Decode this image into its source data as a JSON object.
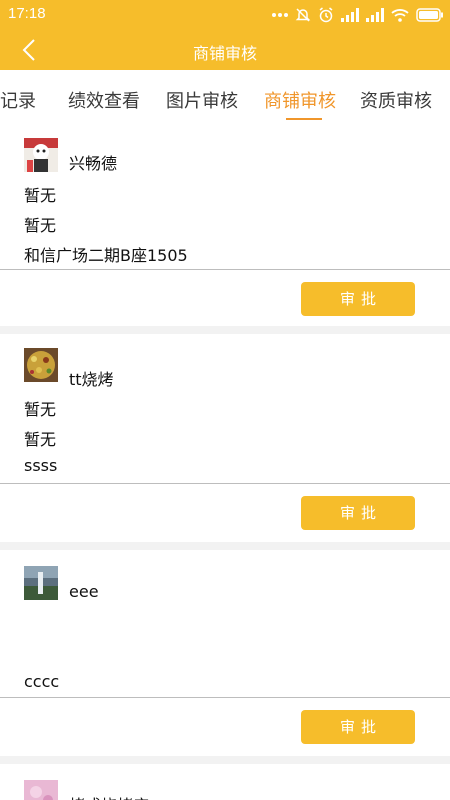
{
  "status_bar": {
    "time": "17:18",
    "icons": [
      "dots-icon",
      "mute-icon",
      "alarm-icon",
      "signal-icon",
      "signal-icon",
      "wifi-icon",
      "battery-icon"
    ]
  },
  "header": {
    "title": "商铺审核",
    "back_icon": "chevron-left-icon"
  },
  "colors": {
    "accent": "#f6bd2b",
    "active_tab": "#f0962b",
    "divider": "#bdbdbd",
    "separator": "#f2f2f2"
  },
  "tabs": [
    {
      "label": "赞记录",
      "active": false
    },
    {
      "label": "绩效查看",
      "active": false
    },
    {
      "label": "图片审核",
      "active": false
    },
    {
      "label": "商铺审核",
      "active": true
    },
    {
      "label": "资质审核",
      "active": false
    }
  ],
  "cards": [
    {
      "name": "兴畅德",
      "line1": "暂无",
      "line2": "暂无",
      "address": "和信广场二期B座1505",
      "button": "审批"
    },
    {
      "name": "tt烧烤",
      "line1": "暂无",
      "line2": "暂无",
      "address": "ssss",
      "button": "审批"
    },
    {
      "name": "eee",
      "line1": "",
      "line2": "",
      "address": "cccc",
      "button": "审批"
    },
    {
      "name": "烤成烧烤店",
      "line1": "",
      "line2": "",
      "address": "",
      "button": ""
    }
  ]
}
